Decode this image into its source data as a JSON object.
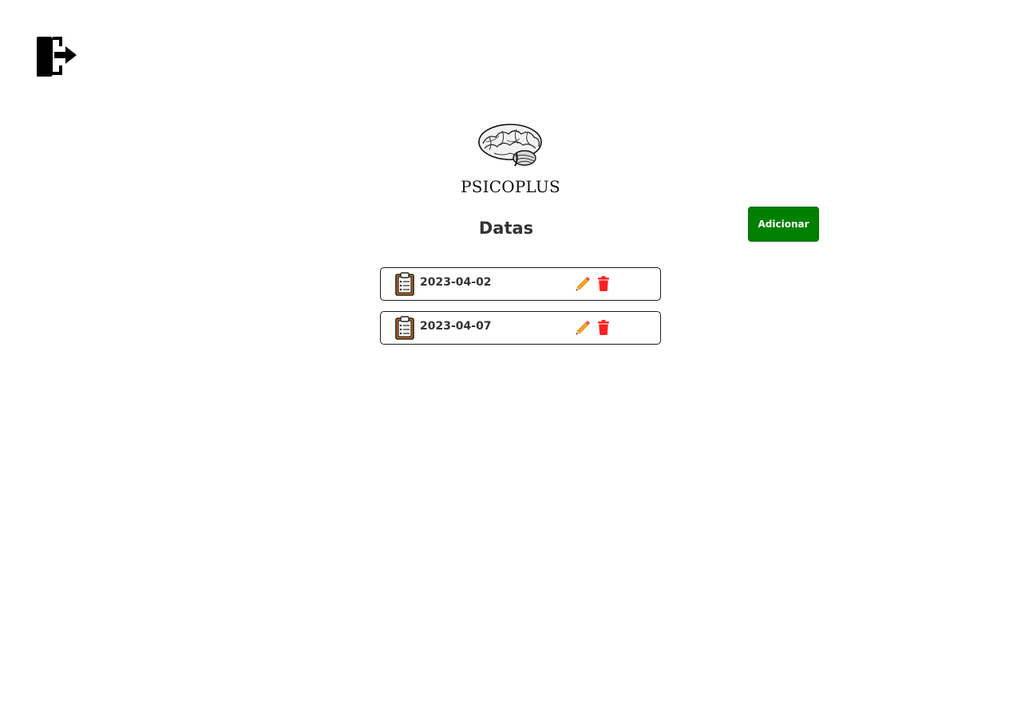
{
  "header": {
    "logout_icon": "logout-door-arrow-icon"
  },
  "brand": {
    "logo_icon": "brain-icon",
    "app_name": "PSICOPLUS"
  },
  "main": {
    "title": "Datas",
    "add_button_label": "Adicionar",
    "add_button_color": "#008000",
    "items": [
      {
        "date": "2023-04-02",
        "icon": "clipboard-icon",
        "actions": [
          "edit-pencil-icon",
          "delete-trash-icon"
        ]
      },
      {
        "date": "2023-04-07",
        "icon": "clipboard-icon",
        "actions": [
          "edit-pencil-icon",
          "delete-trash-icon"
        ]
      }
    ]
  },
  "colors": {
    "delete": "#ff2222",
    "edit": "#f5a623",
    "text": "#333333"
  }
}
